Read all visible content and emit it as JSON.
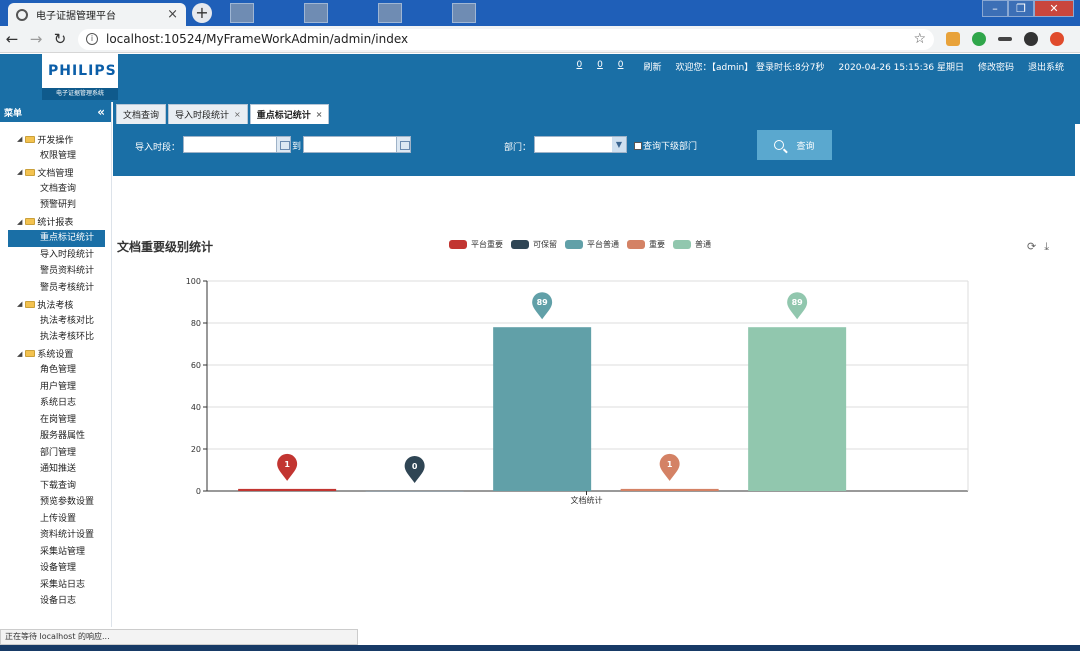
{
  "browser": {
    "tab_title": "电子证据管理平台",
    "tab_close": "×",
    "new_tab": "+",
    "url": "localhost:10524/MyFrameWorkAdmin/admin/index",
    "status": "正在等待 localhost 的响应..."
  },
  "header": {
    "logo_name": "PHILIPS",
    "logo_sub": "电子证据管理系统",
    "counts": [
      "0",
      "0",
      "0"
    ],
    "refresh": "刷新",
    "welcome": "欢迎您：【admin】 登录时长:8分7秒",
    "datetime": "2020-04-26 15:15:36 星期日",
    "change_password": "修改密码",
    "logout": "退出系统"
  },
  "menu": {
    "title": "菜单",
    "collapse": "«",
    "groups": [
      {
        "label": "开发操作",
        "items": [
          "权限管理"
        ]
      },
      {
        "label": "文档管理",
        "items": [
          "文档查询",
          "预警研判"
        ]
      },
      {
        "label": "统计报表",
        "items": [
          "重点标记统计",
          "导入时段统计",
          "警员资料统计",
          "警员考核统计"
        ]
      },
      {
        "label": "执法考核",
        "items": [
          "执法考核对比",
          "执法考核环比"
        ]
      },
      {
        "label": "系统设置",
        "items": [
          "角色管理",
          "用户管理",
          "系统日志",
          "在岗管理",
          "服务器属性",
          "部门管理",
          "通知推送",
          "下载查询",
          "预览参数设置",
          "上传设置",
          "资料统计设置",
          "采集站管理",
          "设备管理",
          "采集站日志",
          "设备日志"
        ]
      }
    ],
    "active": "重点标记统计"
  },
  "tabs": [
    {
      "label": "文档查询",
      "closable": false
    },
    {
      "label": "导入时段统计",
      "closable": true
    },
    {
      "label": "重点标记统计",
      "closable": true,
      "active": true
    }
  ],
  "tab_close": "×",
  "search": {
    "import_label": "导入时段：",
    "to_label": "到",
    "dept_label": "部门：",
    "sub_dept_label": "查询下级部门",
    "query_button": "查询",
    "start_value": "",
    "end_value": "",
    "dept_value": ""
  },
  "chart_data": {
    "type": "bar",
    "title": "文档重要级别统计",
    "categories": [
      "文档统计"
    ],
    "series": [
      {
        "name": "平台重要",
        "values": [
          1
        ],
        "color": "#c23531",
        "pin_label": "1"
      },
      {
        "name": "可保留",
        "values": [
          0
        ],
        "color": "#2f4554",
        "pin_label": "0"
      },
      {
        "name": "平台普通",
        "values": [
          78
        ],
        "color": "#61a0a8",
        "pin_label": "89"
      },
      {
        "name": "重要",
        "values": [
          1
        ],
        "color": "#d48265",
        "pin_label": "1"
      },
      {
        "name": "普通",
        "values": [
          78
        ],
        "color": "#91c7ae",
        "pin_label": "89"
      }
    ],
    "yticks": [
      "0",
      "20",
      "40",
      "60",
      "80",
      "100"
    ],
    "ylim": [
      0,
      100
    ],
    "grid": true,
    "legend_position": "top-center"
  }
}
